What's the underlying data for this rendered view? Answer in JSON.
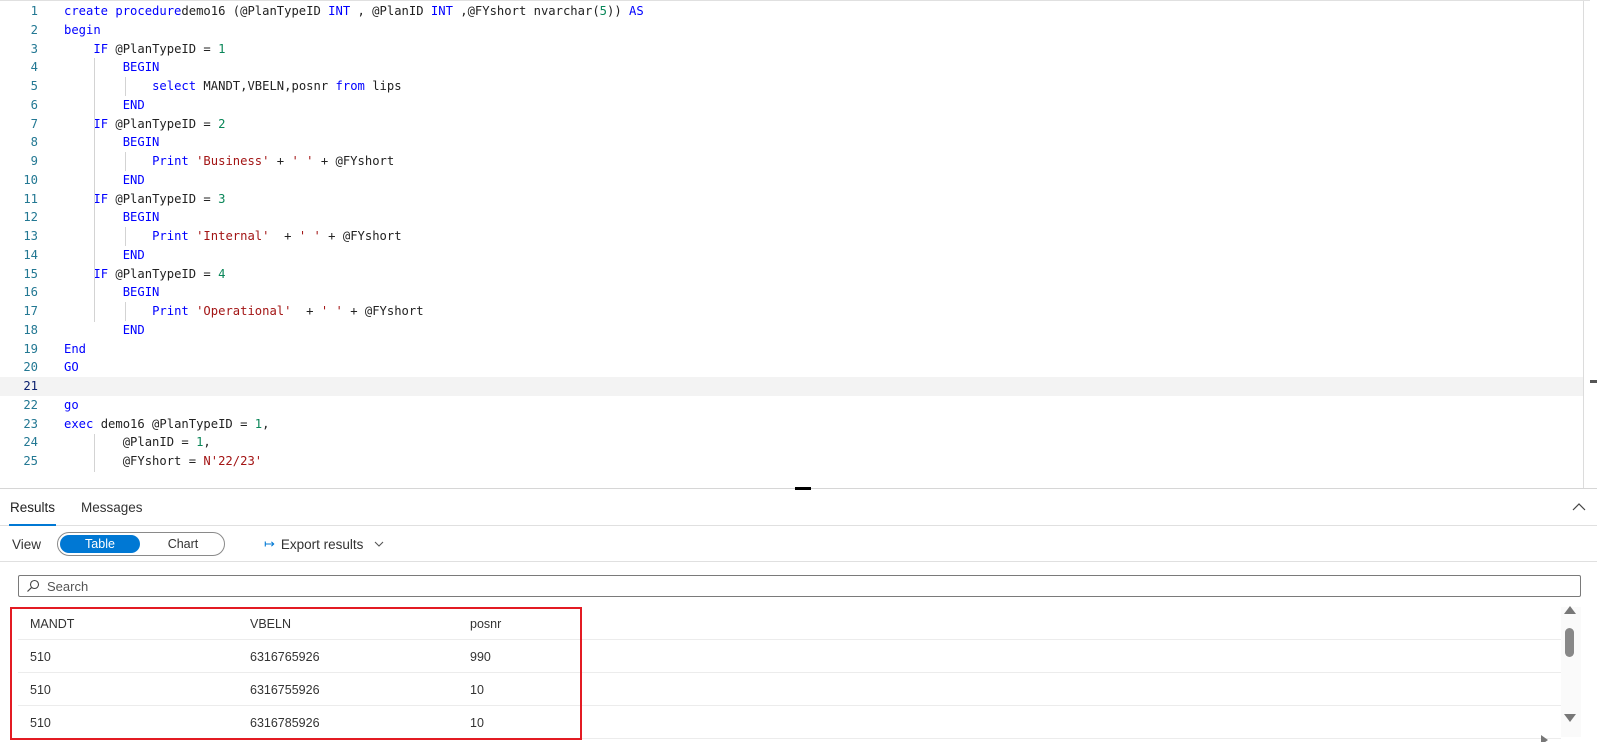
{
  "editor": {
    "lines": [
      {
        "n": "1",
        "tokens": [
          [
            "kw",
            "create procedure"
          ],
          [
            "",
            "demo16 (@PlanTypeID "
          ],
          [
            "kw",
            "INT"
          ],
          [
            "",
            " , @PlanID "
          ],
          [
            "kw",
            "INT"
          ],
          [
            "",
            " ,@FYshort nvarchar("
          ],
          [
            "num",
            "5"
          ],
          [
            "",
            "))"
          ],
          [
            "",
            " "
          ],
          [
            "kw",
            "AS"
          ]
        ]
      },
      {
        "n": "2",
        "tokens": [
          [
            "kw",
            "begin"
          ]
        ]
      },
      {
        "n": "3",
        "tokens": [
          [
            "",
            "    "
          ],
          [
            "kw",
            "IF"
          ],
          [
            "",
            " @PlanTypeID = "
          ],
          [
            "num",
            "1"
          ]
        ]
      },
      {
        "n": "4",
        "tokens": [
          [
            "",
            "        "
          ],
          [
            "kw",
            "BEGIN"
          ]
        ]
      },
      {
        "n": "5",
        "tokens": [
          [
            "",
            "            "
          ],
          [
            "kw",
            "select"
          ],
          [
            "",
            " MANDT,VBELN,posnr "
          ],
          [
            "kw",
            "from"
          ],
          [
            "",
            " lips"
          ]
        ]
      },
      {
        "n": "6",
        "tokens": [
          [
            "",
            "        "
          ],
          [
            "kw",
            "END"
          ]
        ]
      },
      {
        "n": "7",
        "tokens": [
          [
            "",
            "    "
          ],
          [
            "kw",
            "IF"
          ],
          [
            "",
            " @PlanTypeID = "
          ],
          [
            "num",
            "2"
          ]
        ]
      },
      {
        "n": "8",
        "tokens": [
          [
            "",
            "        "
          ],
          [
            "kw",
            "BEGIN"
          ]
        ]
      },
      {
        "n": "9",
        "tokens": [
          [
            "",
            "            "
          ],
          [
            "kw",
            "Print"
          ],
          [
            "",
            " "
          ],
          [
            "str",
            "'Business'"
          ],
          [
            "",
            " + "
          ],
          [
            "str",
            "' '"
          ],
          [
            "",
            " + @FYshort"
          ]
        ]
      },
      {
        "n": "10",
        "tokens": [
          [
            "",
            "        "
          ],
          [
            "kw",
            "END"
          ]
        ]
      },
      {
        "n": "11",
        "tokens": [
          [
            "",
            "    "
          ],
          [
            "kw",
            "IF"
          ],
          [
            "",
            " @PlanTypeID = "
          ],
          [
            "num",
            "3"
          ]
        ]
      },
      {
        "n": "12",
        "tokens": [
          [
            "",
            "        "
          ],
          [
            "kw",
            "BEGIN"
          ]
        ]
      },
      {
        "n": "13",
        "tokens": [
          [
            "",
            "            "
          ],
          [
            "kw",
            "Print"
          ],
          [
            "",
            " "
          ],
          [
            "str",
            "'Internal'"
          ],
          [
            "",
            "  + "
          ],
          [
            "str",
            "' '"
          ],
          [
            "",
            " + @FYshort"
          ]
        ]
      },
      {
        "n": "14",
        "tokens": [
          [
            "",
            "        "
          ],
          [
            "kw",
            "END"
          ]
        ]
      },
      {
        "n": "15",
        "tokens": [
          [
            "",
            "    "
          ],
          [
            "kw",
            "IF"
          ],
          [
            "",
            " @PlanTypeID = "
          ],
          [
            "num",
            "4"
          ]
        ]
      },
      {
        "n": "16",
        "tokens": [
          [
            "",
            "        "
          ],
          [
            "kw",
            "BEGIN"
          ]
        ]
      },
      {
        "n": "17",
        "tokens": [
          [
            "",
            "            "
          ],
          [
            "kw",
            "Print"
          ],
          [
            "",
            " "
          ],
          [
            "str",
            "'Operational'"
          ],
          [
            "",
            "  + "
          ],
          [
            "str",
            "' '"
          ],
          [
            "",
            " + @FYshort"
          ]
        ]
      },
      {
        "n": "18",
        "tokens": [
          [
            "",
            "        "
          ],
          [
            "kw",
            "END"
          ]
        ]
      },
      {
        "n": "19",
        "tokens": [
          [
            "kw",
            "End"
          ]
        ]
      },
      {
        "n": "20",
        "tokens": [
          [
            "kw",
            "GO"
          ]
        ]
      },
      {
        "n": "21",
        "tokens": [],
        "active": true
      },
      {
        "n": "22",
        "tokens": [
          [
            "kw",
            "go"
          ]
        ]
      },
      {
        "n": "23",
        "tokens": [
          [
            "kw",
            "exec"
          ],
          [
            "",
            " demo16 @PlanTypeID = "
          ],
          [
            "num",
            "1"
          ],
          [
            "",
            ","
          ]
        ]
      },
      {
        "n": "24",
        "tokens": [
          [
            "",
            "        @PlanID = "
          ],
          [
            "num",
            "1"
          ],
          [
            "",
            ","
          ]
        ]
      },
      {
        "n": "25",
        "tokens": [
          [
            "",
            "        @FYshort = "
          ],
          [
            "str",
            "N'22/23'"
          ]
        ]
      }
    ]
  },
  "results": {
    "tabs": [
      {
        "label": "Results",
        "active": true
      },
      {
        "label": "Messages",
        "active": false
      }
    ],
    "view_label": "View",
    "view_options": [
      "Table",
      "Chart"
    ],
    "view_selected": "Table",
    "export_label": "Export results",
    "search_placeholder": "Search",
    "columns": [
      "MANDT",
      "VBELN",
      "posnr"
    ],
    "rows": [
      [
        "510",
        "6316765926",
        "990"
      ],
      [
        "510",
        "6316755926",
        "10"
      ],
      [
        "510",
        "6316785926",
        "10"
      ]
    ],
    "highlight_color": "#e31b23",
    "accent_color": "#0078d4"
  }
}
